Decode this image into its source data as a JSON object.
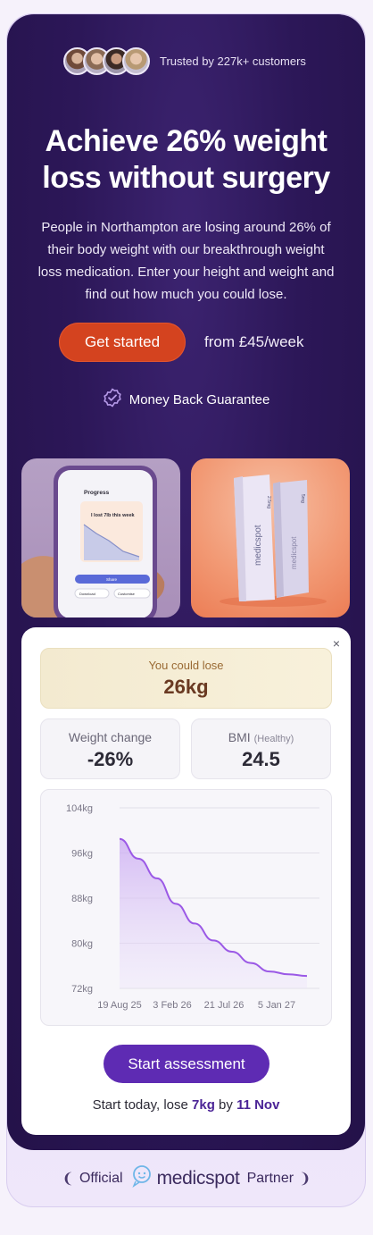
{
  "hero": {
    "trusted_text": "Trusted by 227k+ customers",
    "title_line1": "Achieve 26% weight",
    "title_line2": "loss without surgery",
    "description": "People in Northampton are losing around 26% of their body weight with our breakthrough weight loss medication. Enter your height and weight and find out how much you could lose.",
    "cta_label": "Get started",
    "price_text": "from £45/week",
    "guarantee_text": "Money Back Guarantee"
  },
  "app_screen": {
    "title": "Progress",
    "headline": "I lost 7lb this week",
    "share_label": "Share",
    "download_label": "Download",
    "customise_label": "Customise"
  },
  "product_box": {
    "brand": "medicspot",
    "dose_label": "2.5mg",
    "dose_label_2": "5mg"
  },
  "calculator": {
    "close_label": "×",
    "lose_label": "You could lose",
    "lose_value": "26kg",
    "weight_change_label": "Weight change",
    "weight_change_value": "-26%",
    "bmi_label": "BMI",
    "bmi_category": "(Healthy)",
    "bmi_value": "24.5",
    "assess_label": "Start assessment",
    "start_prefix": "Start today, lose ",
    "start_amount": "7kg",
    "start_mid": " by ",
    "start_date": "11 Nov"
  },
  "chart_data": {
    "type": "area",
    "y_ticks": [
      "104kg",
      "96kg",
      "88kg",
      "80kg",
      "72kg"
    ],
    "x_ticks": [
      "19 Aug 25",
      "3 Feb 26",
      "21 Jul 26",
      "5 Jan 27"
    ],
    "ylim": [
      72,
      104
    ],
    "x": [
      "19 Aug 25",
      "Oct 25",
      "Dec 25",
      "Feb 26",
      "Apr 26",
      "Jun 26",
      "Aug 26",
      "Oct 26",
      "Dec 26",
      "Feb 27",
      "Mar 27"
    ],
    "values": [
      98.5,
      95,
      91.5,
      87,
      83.5,
      80.5,
      78.5,
      76.5,
      75,
      74.5,
      74.2
    ],
    "line_color": "#9b59e6",
    "grid": true
  },
  "partner": {
    "official": "Official",
    "brand": "medicspot",
    "partner": "Partner"
  },
  "colors": {
    "panel": "#2c1758",
    "cta": "#d4431f",
    "assess": "#5e2bb3"
  }
}
